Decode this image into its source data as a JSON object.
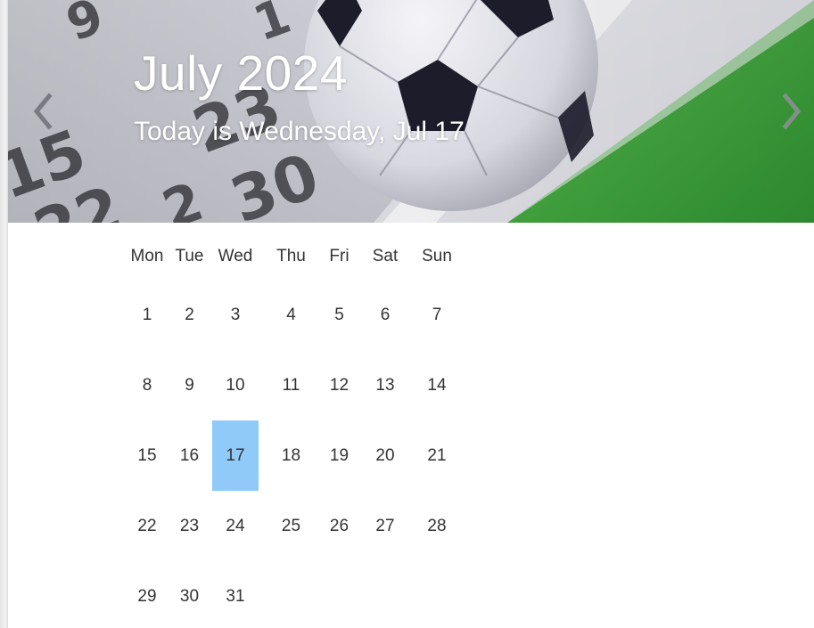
{
  "header": {
    "month_title": "July 2024",
    "today_text": "Today is Wednesday, Jul 17",
    "prev_icon": "chevron-left-icon",
    "next_icon": "chevron-right-icon"
  },
  "calendar": {
    "weekdays": [
      "Mon",
      "Tue",
      "Wed",
      "Thu",
      "Fri",
      "Sat",
      "Sun"
    ],
    "weeks": [
      [
        "1",
        "2",
        "3",
        "4",
        "5",
        "6",
        "7"
      ],
      [
        "8",
        "9",
        "10",
        "11",
        "12",
        "13",
        "14"
      ],
      [
        "15",
        "16",
        "17",
        "18",
        "19",
        "20",
        "21"
      ],
      [
        "22",
        "23",
        "24",
        "25",
        "26",
        "27",
        "28"
      ],
      [
        "29",
        "30",
        "31",
        "",
        "",
        "",
        ""
      ]
    ],
    "today": "17",
    "highlight_color": "#90caf9"
  }
}
